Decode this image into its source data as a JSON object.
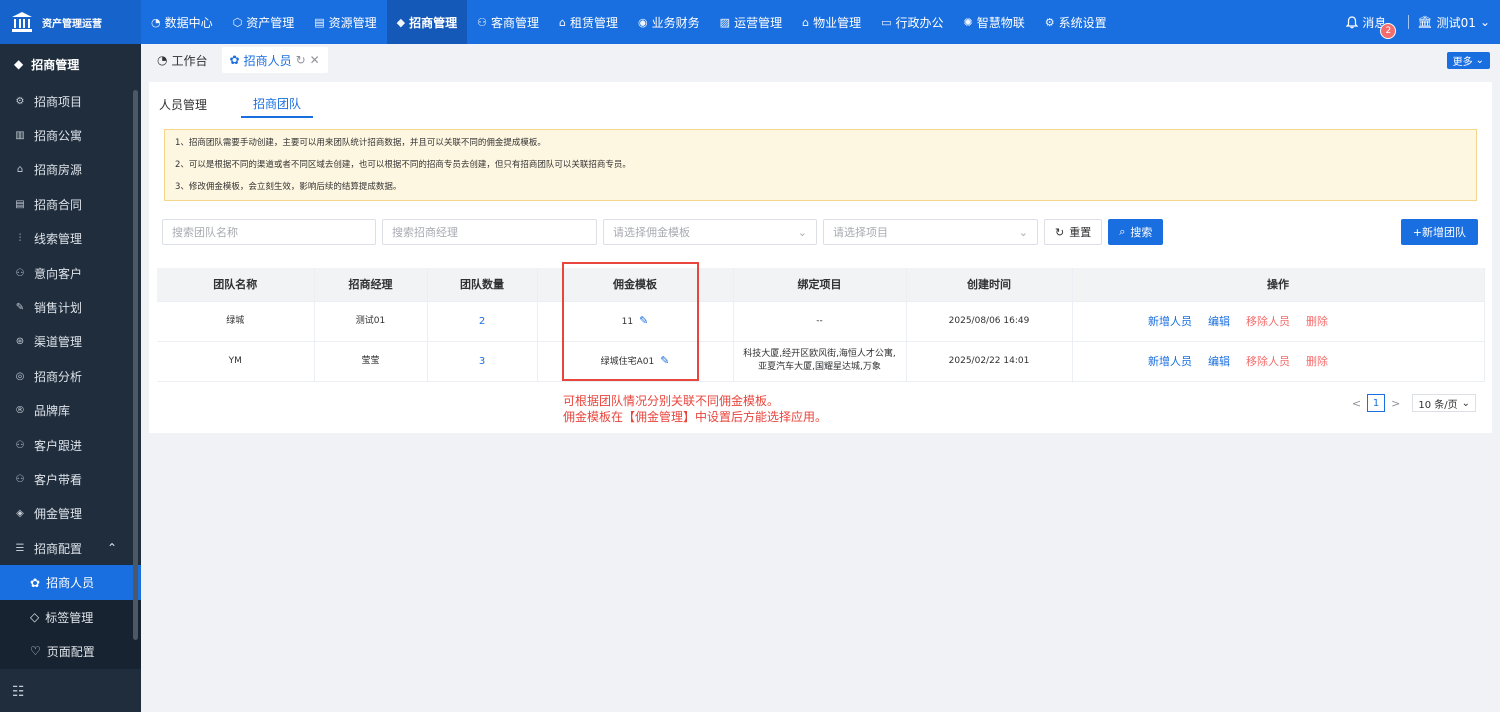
{
  "app": {
    "brand": "资产管理运营"
  },
  "topnav": [
    {
      "label": "数据中心",
      "icon": "◔"
    },
    {
      "label": "资产管理",
      "icon": "⬡"
    },
    {
      "label": "资源管理",
      "icon": "▤"
    },
    {
      "label": "招商管理",
      "icon": "◆",
      "active": true
    },
    {
      "label": "客商管理",
      "icon": "⚇"
    },
    {
      "label": "租赁管理",
      "icon": "⌂"
    },
    {
      "label": "业务财务",
      "icon": "◉"
    },
    {
      "label": "运营管理",
      "icon": "▨"
    },
    {
      "label": "物业管理",
      "icon": "⌂"
    },
    {
      "label": "行政办公",
      "icon": "▭"
    },
    {
      "label": "智慧物联",
      "icon": "✺"
    },
    {
      "label": "系统设置",
      "icon": "⚙"
    }
  ],
  "header": {
    "messages_label": "消息",
    "messages_count": "2",
    "user": "测试01"
  },
  "sidebar": {
    "title": "招商管理",
    "items": [
      {
        "label": "招商项目",
        "icon": "⚙"
      },
      {
        "label": "招商公寓",
        "icon": "▥"
      },
      {
        "label": "招商房源",
        "icon": "⌂"
      },
      {
        "label": "招商合同",
        "icon": "▤"
      },
      {
        "label": "线索管理",
        "icon": "⫶"
      },
      {
        "label": "意向客户",
        "icon": "⚇"
      },
      {
        "label": "销售计划",
        "icon": "✎"
      },
      {
        "label": "渠道管理",
        "icon": "⊛"
      },
      {
        "label": "招商分析",
        "icon": "◎"
      },
      {
        "label": "品牌库",
        "icon": "®"
      },
      {
        "label": "客户跟进",
        "icon": "⚇"
      },
      {
        "label": "客户带看",
        "icon": "⚇"
      },
      {
        "label": "佣金管理",
        "icon": "◈"
      }
    ],
    "group": {
      "label": "招商配置",
      "icon": "☰"
    },
    "sub_items": [
      {
        "label": "招商人员",
        "icon": "✿",
        "active": true
      },
      {
        "label": "标签管理",
        "icon": "◇"
      },
      {
        "label": "页面配置",
        "icon": "♡"
      }
    ]
  },
  "tabs": [
    {
      "label": "工作台",
      "icon": "◔"
    },
    {
      "label": "招商人员",
      "icon": "✿",
      "active": true
    }
  ],
  "more_label": "更多",
  "subtabs": [
    "人员管理",
    "招商团队"
  ],
  "notice": [
    "1、招商团队需要手动创建，主要可以用来团队统计招商数据，并且可以关联不同的佣金提成模板。",
    "2、可以是根据不同的渠道或者不同区域去创建，也可以根据不同的招商专员去创建，但只有招商团队可以关联招商专员。",
    "3、修改佣金模板，会立刻生效，影响后续的结算提成数据。"
  ],
  "filters": {
    "team_name": "搜索团队名称",
    "manager": "搜索招商经理",
    "template": "请选择佣金模板",
    "project": "请选择项目",
    "reset": "重置",
    "search": "搜索",
    "add": "+新增团队"
  },
  "table": {
    "columns": [
      "团队名称",
      "招商经理",
      "团队数量",
      "佣金模板",
      "绑定项目",
      "创建时间",
      "操作"
    ],
    "rows": [
      {
        "name": "绿城",
        "manager": "测试01",
        "count": "2",
        "template": "11",
        "project": "--",
        "created": "2025/08/06 16:49"
      },
      {
        "name": "YM",
        "manager": "莹莹",
        "count": "3",
        "template": "绿城住宅A01",
        "project": "科技大厦,经开区欧风街,海恒人才公寓,亚夏汽车大厦,国耀星达城,万象",
        "created": "2025/02/22 14:01"
      }
    ],
    "actions": {
      "add_member": "新增人员",
      "edit": "编辑",
      "remove_member": "移除人员",
      "delete": "删除"
    }
  },
  "annotation": [
    "可根据团队情况分别关联不同佣金模板。",
    "佣金模板在【佣金管理】中设置后方能选择应用。"
  ],
  "pagination": {
    "prev": "<",
    "page": "1",
    "next": ">",
    "page_size": "10 条/页"
  },
  "colors": {
    "primary": "#1a6fe0",
    "sidebar": "#1f2d3d",
    "danger": "#f56c6c",
    "highlight": "#e8453c"
  }
}
